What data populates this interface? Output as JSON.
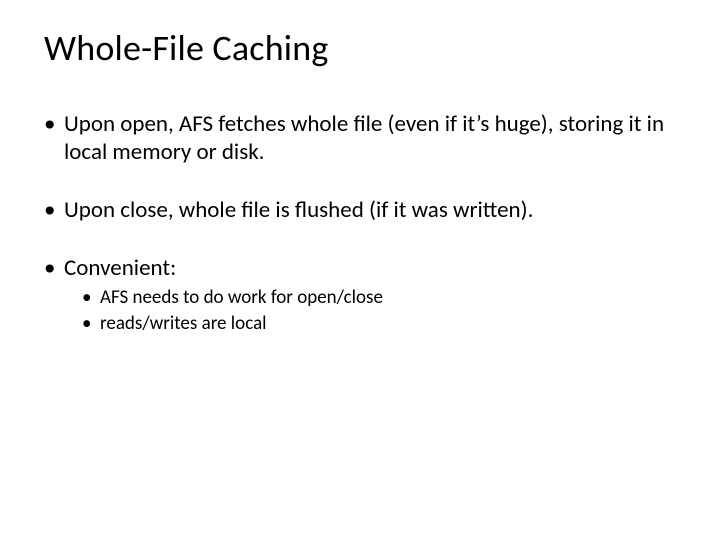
{
  "title": "Whole-File Caching",
  "bullets": {
    "b1": "Upon open, AFS fetches whole file (even if it’s huge), storing it in local memory or disk.",
    "b2": "Upon close, whole file is flushed (if it was written).",
    "b3": "Convenient:",
    "b3_sub": {
      "s1": "AFS needs to do work for open/close",
      "s2": "reads/writes are local"
    }
  }
}
